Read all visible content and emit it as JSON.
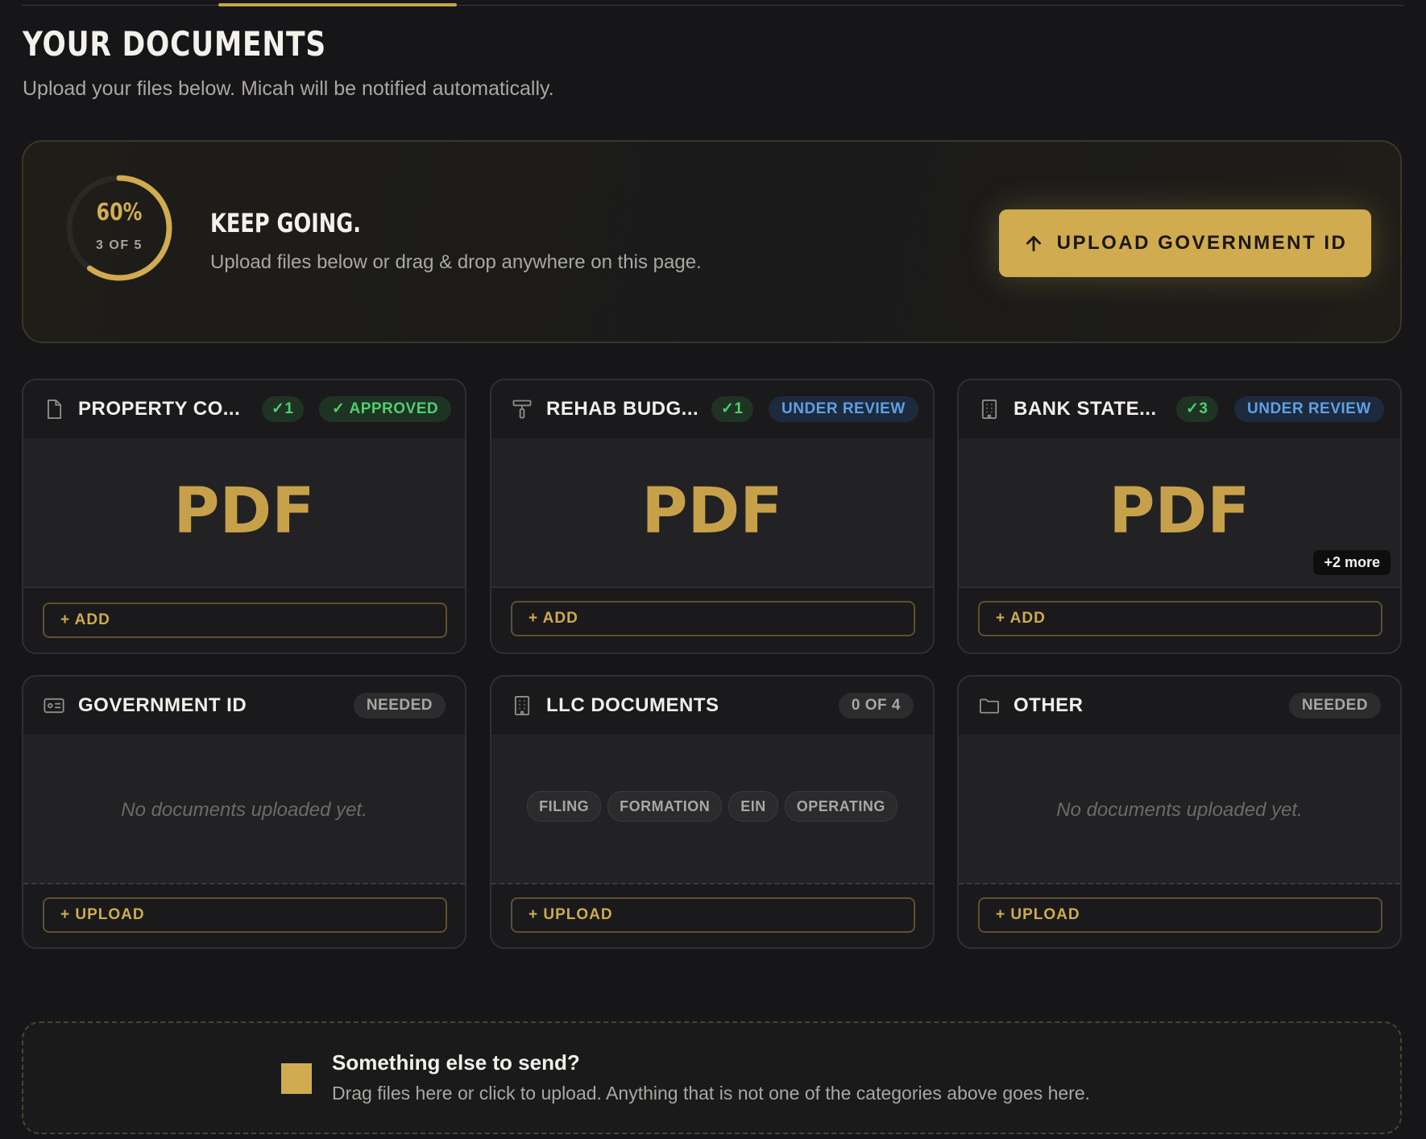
{
  "header": {
    "title": "YOUR DOCUMENTS",
    "subtitle": "Upload your files below. Micah will be notified automatically."
  },
  "progress": {
    "percent_label": "60%",
    "fraction": 0.6,
    "count_label": "3 OF 5",
    "title": "KEEP GOING.",
    "subtitle": "Upload files below or drag & drop anywhere on this page.",
    "cta_label": "UPLOAD GOVERNMENT ID",
    "cta_icon": "arrow-up-icon"
  },
  "colors": {
    "accent": "#d0ab4f",
    "approved": "#4fcf70",
    "review": "#5f9fe8",
    "background": "#161618"
  },
  "cards": [
    {
      "icon": "file-icon",
      "title": "PROPERTY CO...",
      "count": "✓1",
      "status": "✓ APPROVED",
      "preview": "PDF",
      "action": "+ ADD"
    },
    {
      "icon": "paint-roller-icon",
      "title": "REHAB BUDG...",
      "count": "✓1",
      "status": "UNDER REVIEW",
      "preview": "PDF",
      "action": "+ ADD"
    },
    {
      "icon": "building-icon",
      "title": "BANK STATE...",
      "count": "✓3",
      "status": "UNDER REVIEW",
      "preview": "PDF",
      "more": "+2 more",
      "action": "+ ADD"
    },
    {
      "icon": "id-card-icon",
      "title": "GOVERNMENT ID",
      "status": "NEEDED",
      "empty": "No documents uploaded yet.",
      "action": "+ UPLOAD"
    },
    {
      "icon": "building-icon",
      "title": "LLC DOCUMENTS",
      "status": "0 OF 4",
      "tags": [
        "FILING",
        "FORMATION",
        "EIN",
        "OPERATING"
      ],
      "action": "+ UPLOAD"
    },
    {
      "icon": "folder-icon",
      "title": "OTHER",
      "status": "NEEDED",
      "empty": "No documents uploaded yet.",
      "action": "+ UPLOAD"
    }
  ],
  "dropzone": {
    "title": "Something else to send?",
    "subtitle": "Drag files here or click to upload. Anything that is not one of the categories above goes here."
  }
}
